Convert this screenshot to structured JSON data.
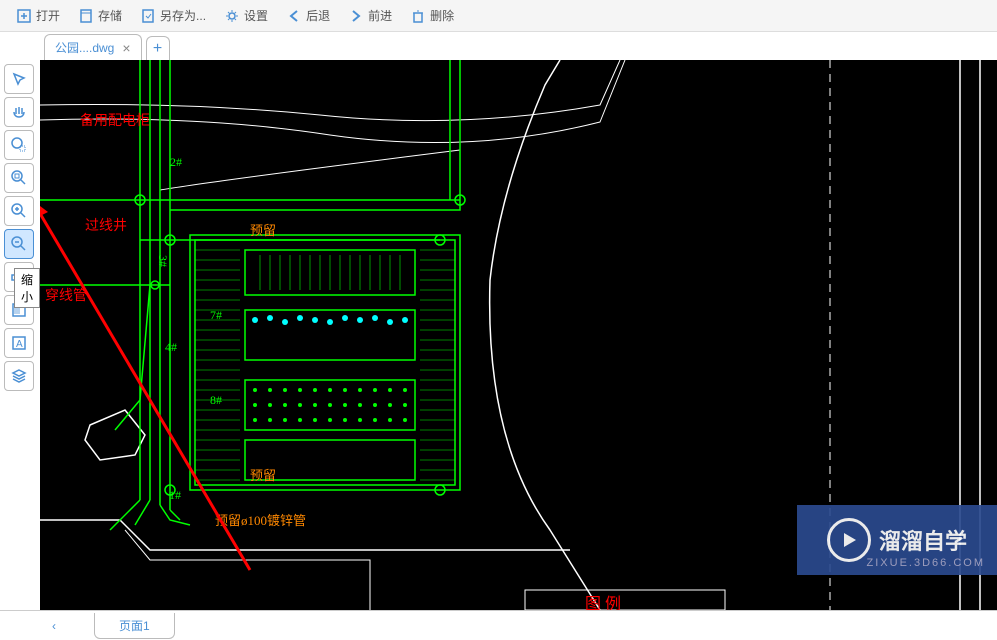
{
  "toolbar": {
    "open": "打开",
    "save": "存储",
    "save_as": "另存为...",
    "settings": "设置",
    "back": "后退",
    "forward": "前进",
    "delete": "删除"
  },
  "tabs": {
    "file_tab": "公园....dwg"
  },
  "palette": {
    "tooltip_zoom_out": "缩小"
  },
  "cad": {
    "backup_cabinet": "备用配电柜",
    "junction_box": "过线井",
    "conduit": "穿线管",
    "reserve": "预留",
    "reserve_pipe": "预留ø100镀锌管",
    "mark_1": "1#",
    "mark_2": "2#",
    "mark_3": "3#",
    "mark_4": "4#",
    "mark_7": "7#",
    "mark_8": "8#",
    "legend": "图    例"
  },
  "pages": {
    "page1": "页面1"
  },
  "watermark": {
    "brand": "溜溜自学",
    "url": "ZIXUE.3D66.COM"
  },
  "colors": {
    "icon_blue": "#4a8fd4",
    "cad_green": "#00ff00",
    "cad_red": "#ff0000",
    "cad_white": "#ffffff",
    "cad_cyan": "#00ffff",
    "cad_orange": "#ff8800"
  }
}
